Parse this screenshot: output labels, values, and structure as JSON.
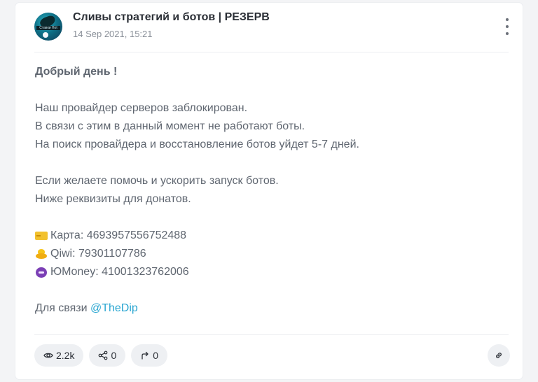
{
  "post": {
    "channel_title": "Сливы стратегий и ботов | РЕЗЕРВ",
    "timestamp": "14 Sep 2021, 15:21",
    "avatar_label": "Ставки Hot",
    "greeting": "Добрый день !",
    "para1": [
      "Наш провайдер серверов заблокирован.",
      "В связи с этим в данный момент не работают боты.",
      "На поиск провайдера и восстановление ботов уйдет 5-7 дней."
    ],
    "para2": [
      "Если желаете помочь и ускорить запуск ботов.",
      "Ниже реквизиты для донатов."
    ],
    "payments": [
      {
        "icon": "bank-card-icon",
        "text": "Карта: 4693957556752488"
      },
      {
        "icon": "duck-icon",
        "text": "Qiwi: 79301107786"
      },
      {
        "icon": "demon-face-icon",
        "text": "ЮMoney: 41001323762006"
      }
    ],
    "contact_label": "Для связи ",
    "contact_link": "@TheDip"
  },
  "footer": {
    "views": "2.2k",
    "shares": "0",
    "forwards": "0"
  },
  "colors": {
    "link": "#2aa6d1",
    "text_muted": "#5f6670",
    "pill_bg": "#eef0f3"
  }
}
